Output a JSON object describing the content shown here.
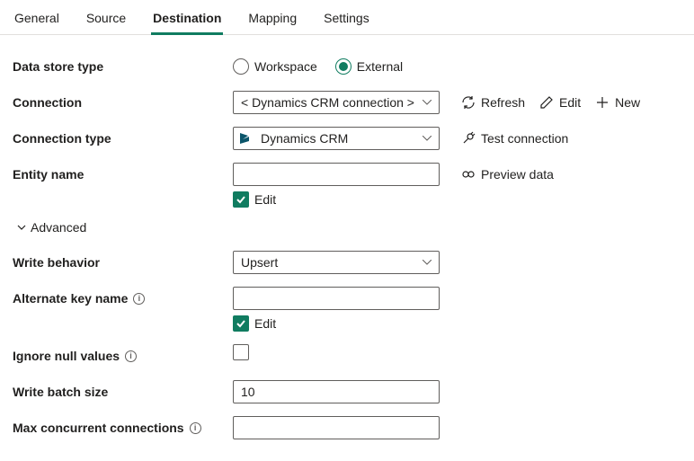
{
  "tabs": {
    "general": "General",
    "source": "Source",
    "destination": "Destination",
    "mapping": "Mapping",
    "settings": "Settings"
  },
  "labels": {
    "data_store_type": "Data store type",
    "connection": "Connection",
    "connection_type": "Connection type",
    "entity_name": "Entity name",
    "advanced": "Advanced",
    "write_behavior": "Write behavior",
    "alternate_key_name": "Alternate key name",
    "ignore_null_values": "Ignore null values",
    "write_batch_size": "Write batch size",
    "max_concurrent_connections": "Max concurrent connections"
  },
  "radios": {
    "workspace": "Workspace",
    "external": "External"
  },
  "values": {
    "connection": "< Dynamics CRM connection >",
    "connection_type": "Dynamics CRM",
    "entity_name": "",
    "write_behavior": "Upsert",
    "alternate_key_name": "",
    "write_batch_size": "10",
    "max_concurrent_connections": ""
  },
  "actions": {
    "refresh": "Refresh",
    "edit": "Edit",
    "new": "New",
    "test_connection": "Test connection",
    "preview_data": "Preview data"
  },
  "checkbox_labels": {
    "edit": "Edit"
  }
}
